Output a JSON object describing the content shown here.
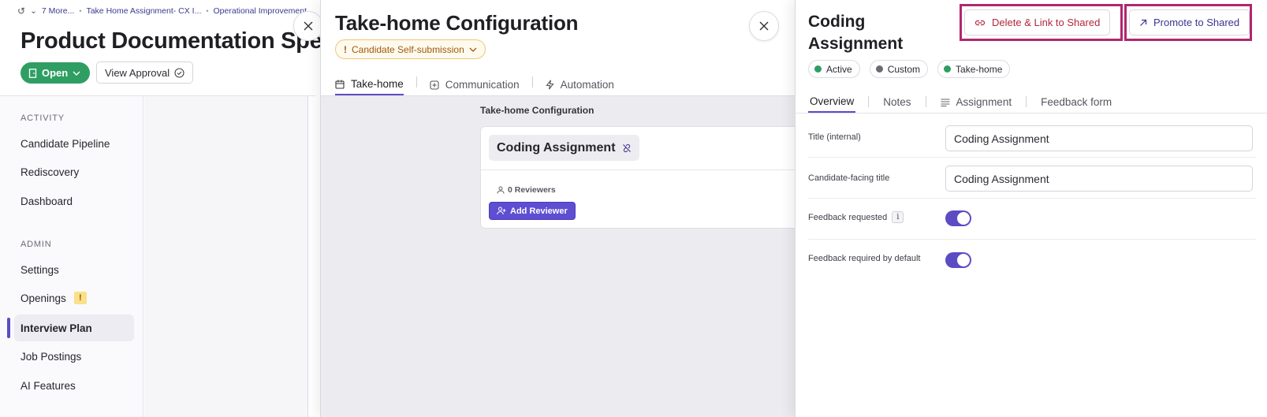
{
  "breadcrumb": {
    "more_label": "7 More...",
    "items": [
      "Take Home Assignment- CX I...",
      "Operational Improvement"
    ]
  },
  "page": {
    "title": "Product Documentation Specialist",
    "status_label": "Open",
    "view_approval_label": "View Approval"
  },
  "sidebar": {
    "activity_header": "ACTIVITY",
    "activity_items": [
      {
        "label": "Candidate Pipeline"
      },
      {
        "label": "Rediscovery"
      },
      {
        "label": "Dashboard"
      }
    ],
    "admin_header": "ADMIN",
    "admin_items": [
      {
        "label": "Settings"
      },
      {
        "label": "Openings",
        "badge": "!"
      },
      {
        "label": "Interview Plan",
        "active": true
      },
      {
        "label": "Job Postings"
      },
      {
        "label": "AI Features"
      }
    ]
  },
  "takehome_panel": {
    "title": "Take-home Configuration",
    "badge": "Candidate Self-submission",
    "badge_icon": "!",
    "tabs": [
      {
        "label": "Take-home",
        "icon": "calendar-icon",
        "active": true
      },
      {
        "label": "Communication",
        "icon": "plus-square-icon"
      },
      {
        "label": "Automation",
        "icon": "bolt-icon"
      }
    ],
    "section_title": "Take-home Configuration",
    "assignment_name": "Coding Assignment",
    "reviewers_label": "0 Reviewers",
    "add_reviewer_label": "Add Reviewer"
  },
  "assignment_panel": {
    "title": "Coding Assignment",
    "delete_link_label": "Delete & Link to Shared",
    "promote_label": "Promote to Shared",
    "statuses": [
      {
        "label": "Active",
        "color": "#2f9e63"
      },
      {
        "label": "Custom",
        "color": "#6b6b75"
      },
      {
        "label": "Take-home",
        "color": "#2f9e63"
      }
    ],
    "tabs": [
      {
        "label": "Overview",
        "active": true
      },
      {
        "label": "Notes"
      },
      {
        "label": "Assignment",
        "icon": "list-icon"
      },
      {
        "label": "Feedback form"
      }
    ],
    "fields": {
      "title_internal_label": "Title (internal)",
      "title_internal_value": "Coding Assignment",
      "candidate_title_label": "Candidate-facing title",
      "candidate_title_value": "Coding Assignment",
      "feedback_requested_label": "Feedback requested",
      "feedback_requested_info": "i",
      "feedback_requested_on": true,
      "feedback_required_label": "Feedback required by default",
      "feedback_required_on": true
    }
  },
  "colors": {
    "accent": "#5b4cc4",
    "success": "#2f9e63",
    "highlight": "#b0276f"
  }
}
